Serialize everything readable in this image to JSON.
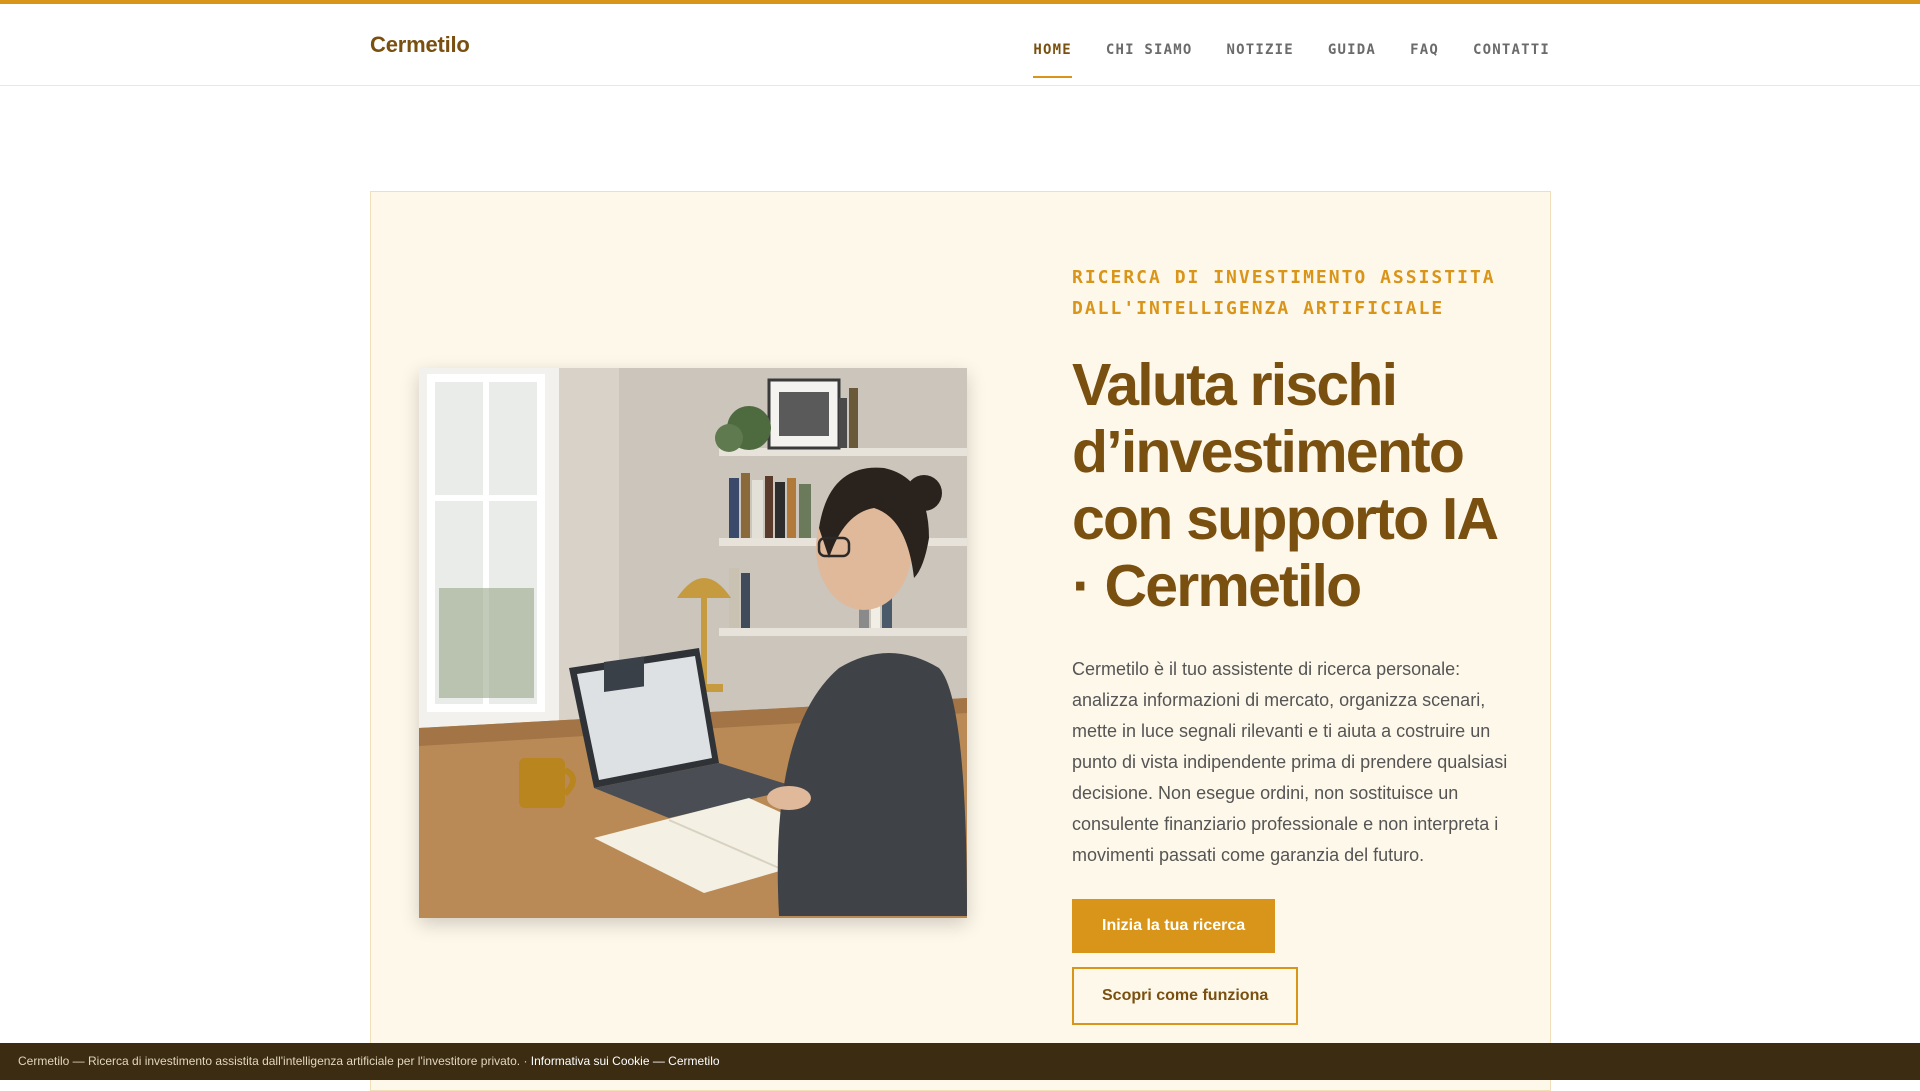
{
  "header": {
    "brand": "Cermetilo",
    "nav": [
      {
        "label": "HOME",
        "active": true
      },
      {
        "label": "CHI SIAMO",
        "active": false
      },
      {
        "label": "NOTIZIE",
        "active": false
      },
      {
        "label": "GUIDA",
        "active": false
      },
      {
        "label": "FAQ",
        "active": false
      },
      {
        "label": "CONTATTI",
        "active": false
      }
    ]
  },
  "hero": {
    "image": {
      "icon": "woman-at-desk-with-laptop-photo"
    },
    "eyebrow": "RICERCA DI INVESTIMENTO ASSISTITA DALL'INTELLIGENZA ARTIFICIALE",
    "headline": "Valuta rischi d’investimento con supporto IA · Cermetilo",
    "description": "Cermetilo è il tuo assistente di ricerca personale: analizza informazioni di mercato, organizza scenari, mette in luce segnali rilevanti e ti aiuta a costruire un punto di vista indipendente prima di prendere qualsiasi decisione. Non esegue ordini, non sostituisce un consulente finanziario professionale e non interpreta i movimenti passati come garanzia del futuro.",
    "primary_button": "Inizia la tua ricerca",
    "secondary_button": "Scopri come funziona"
  },
  "cookie_bar": {
    "text": "Cermetilo — Ricerca di investimento assistita dall'intelligenza artificiale per l'investitore privato. · ",
    "link": "Informativa sui Cookie — Cermetilo"
  },
  "colors": {
    "accent": "#d9951a",
    "brand": "#7a5010",
    "hero_bg": "#fef8ea",
    "cookie_bg": "#3b2c12"
  }
}
